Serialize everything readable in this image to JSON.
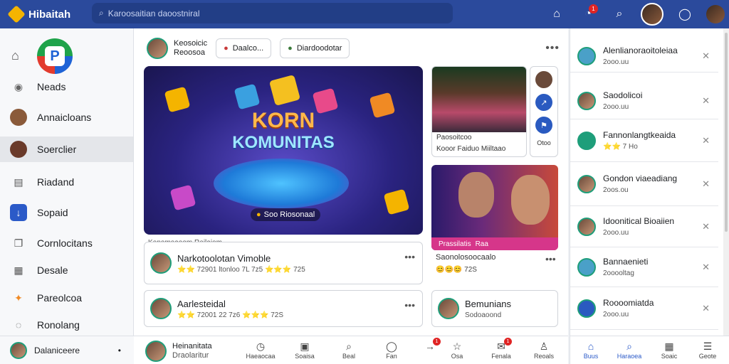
{
  "topbar": {
    "brand": "Hibaitah",
    "search_placeholder": "Karoosaitian daoostniral",
    "notif_badge": "1"
  },
  "sidebar": {
    "items": [
      {
        "label": "Neads",
        "icon": "message-icon"
      },
      {
        "label": "Annaicloans",
        "icon": "avatar-icon"
      },
      {
        "label": "Soerclier",
        "icon": "avatar-icon"
      },
      {
        "label": "Riadand",
        "icon": "document-icon"
      },
      {
        "label": "Sopaid",
        "icon": "download-icon"
      },
      {
        "label": "Cornlocitans",
        "icon": "copy-icon"
      },
      {
        "label": "Desale",
        "icon": "calendar-icon"
      },
      {
        "label": "Pareolcoa",
        "icon": "fire-icon"
      },
      {
        "label": "Ronolang",
        "icon": "chat-icon"
      }
    ],
    "footer_user": "Dalaniceere"
  },
  "stories": {
    "user_name": "Keosoicic",
    "user_sub": "Reoosoa",
    "chip1": "Daalco...",
    "chip2": "Diardoodotar"
  },
  "hero": {
    "title1": "KORN",
    "title2": "KOMUNITAS",
    "pill": "Soo Riosonaal",
    "caption": "Konomoaoom Reilaiom"
  },
  "photo1": {
    "caption1": "Paosoitcoo",
    "caption2": "Kooor Faiduo Miiltaao",
    "side_label": "Otoo"
  },
  "photo2": {
    "bar_text": "Prassilatis",
    "bar_text2": "Raa",
    "caption": "Saonolosoocaalo",
    "reactions": "😊😊😊 72S"
  },
  "posts": [
    {
      "name": "Narkotoolotan Vimoble",
      "meta": "⭐⭐ 72901 ltonloo 7L 7z5 ⭐⭐⭐ 725"
    },
    {
      "name": "Aarlesteidal",
      "meta": "⭐⭐ 72001 22 7z6 ⭐⭐⭐ 72S"
    }
  ],
  "post3": {
    "name": "Bemunians",
    "meta": "Sodoaoond"
  },
  "bottom_nav": {
    "user_name": "Heinanitata",
    "user_sub": "Draolaritur",
    "items": [
      {
        "label": "Haeaocaa",
        "icon": "clock-icon"
      },
      {
        "label": "Soaisa",
        "icon": "image-icon"
      },
      {
        "label": "Beal",
        "icon": "search-icon"
      },
      {
        "label": "Fan",
        "icon": "circle-icon"
      },
      {
        "label": "",
        "icon": "bell-icon",
        "badge": "1"
      },
      {
        "label": "Osa",
        "icon": "star-icon"
      },
      {
        "label": "Fenala",
        "icon": "mail-icon",
        "badge": "1"
      },
      {
        "label": "Reoals",
        "icon": "person-icon"
      }
    ]
  },
  "notifications": [
    {
      "title": "Alenlianoraoitoleiaa",
      "sub": "2ooo.uu"
    },
    {
      "title": "Saodolicoi",
      "sub": "2ooo.uu"
    },
    {
      "title": "Fannonlangtkeaida",
      "sub": "⭐⭐ 7 Ho"
    },
    {
      "title": "Gondon viaeadiang",
      "sub": "2oos.ou"
    },
    {
      "title": "Idoonitical Bioaiien",
      "sub": "2ooo.uu"
    },
    {
      "title": "Bannaenieti",
      "sub": "2ooooltag"
    },
    {
      "title": "Roooomiatda",
      "sub": "2ooo.uu"
    }
  ],
  "right_nav": [
    {
      "label": "Buus",
      "icon": "home-icon"
    },
    {
      "label": "Haraoea",
      "icon": "search-icon"
    },
    {
      "label": "Soaic",
      "icon": "calendar-icon"
    },
    {
      "label": "Geote",
      "icon": "menu-icon"
    }
  ],
  "colors": {
    "topbar": "#2b4a9c",
    "accent": "#2b5ac8",
    "badge": "#e02424"
  }
}
